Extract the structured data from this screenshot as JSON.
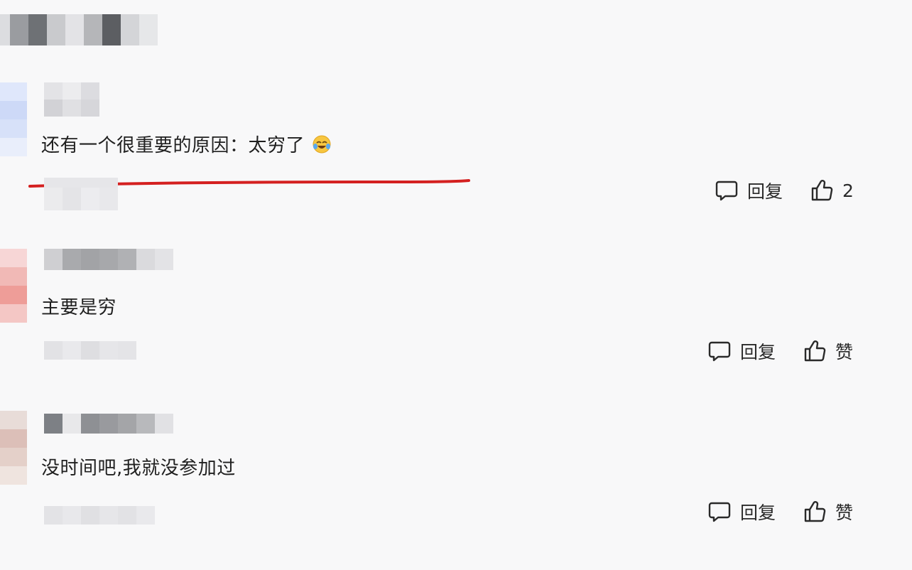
{
  "comments": [
    {
      "text": "还有一个很重要的原因：太穷了",
      "emoji": "laughing-crying-emoji",
      "highlighted": true,
      "reply_label": "回复",
      "like_label": "2"
    },
    {
      "text": "主要是穷",
      "reply_label": "回复",
      "like_label": "赞"
    },
    {
      "text": "没时间吧,我就没参加过",
      "reply_label": "回复",
      "like_label": "赞"
    }
  ],
  "colors": {
    "background": "#f8f8f9",
    "underline": "#d42020",
    "text": "#1f1f1f"
  },
  "icons": {
    "reply": "comment-bubble-icon",
    "like": "thumbs-up-icon"
  }
}
